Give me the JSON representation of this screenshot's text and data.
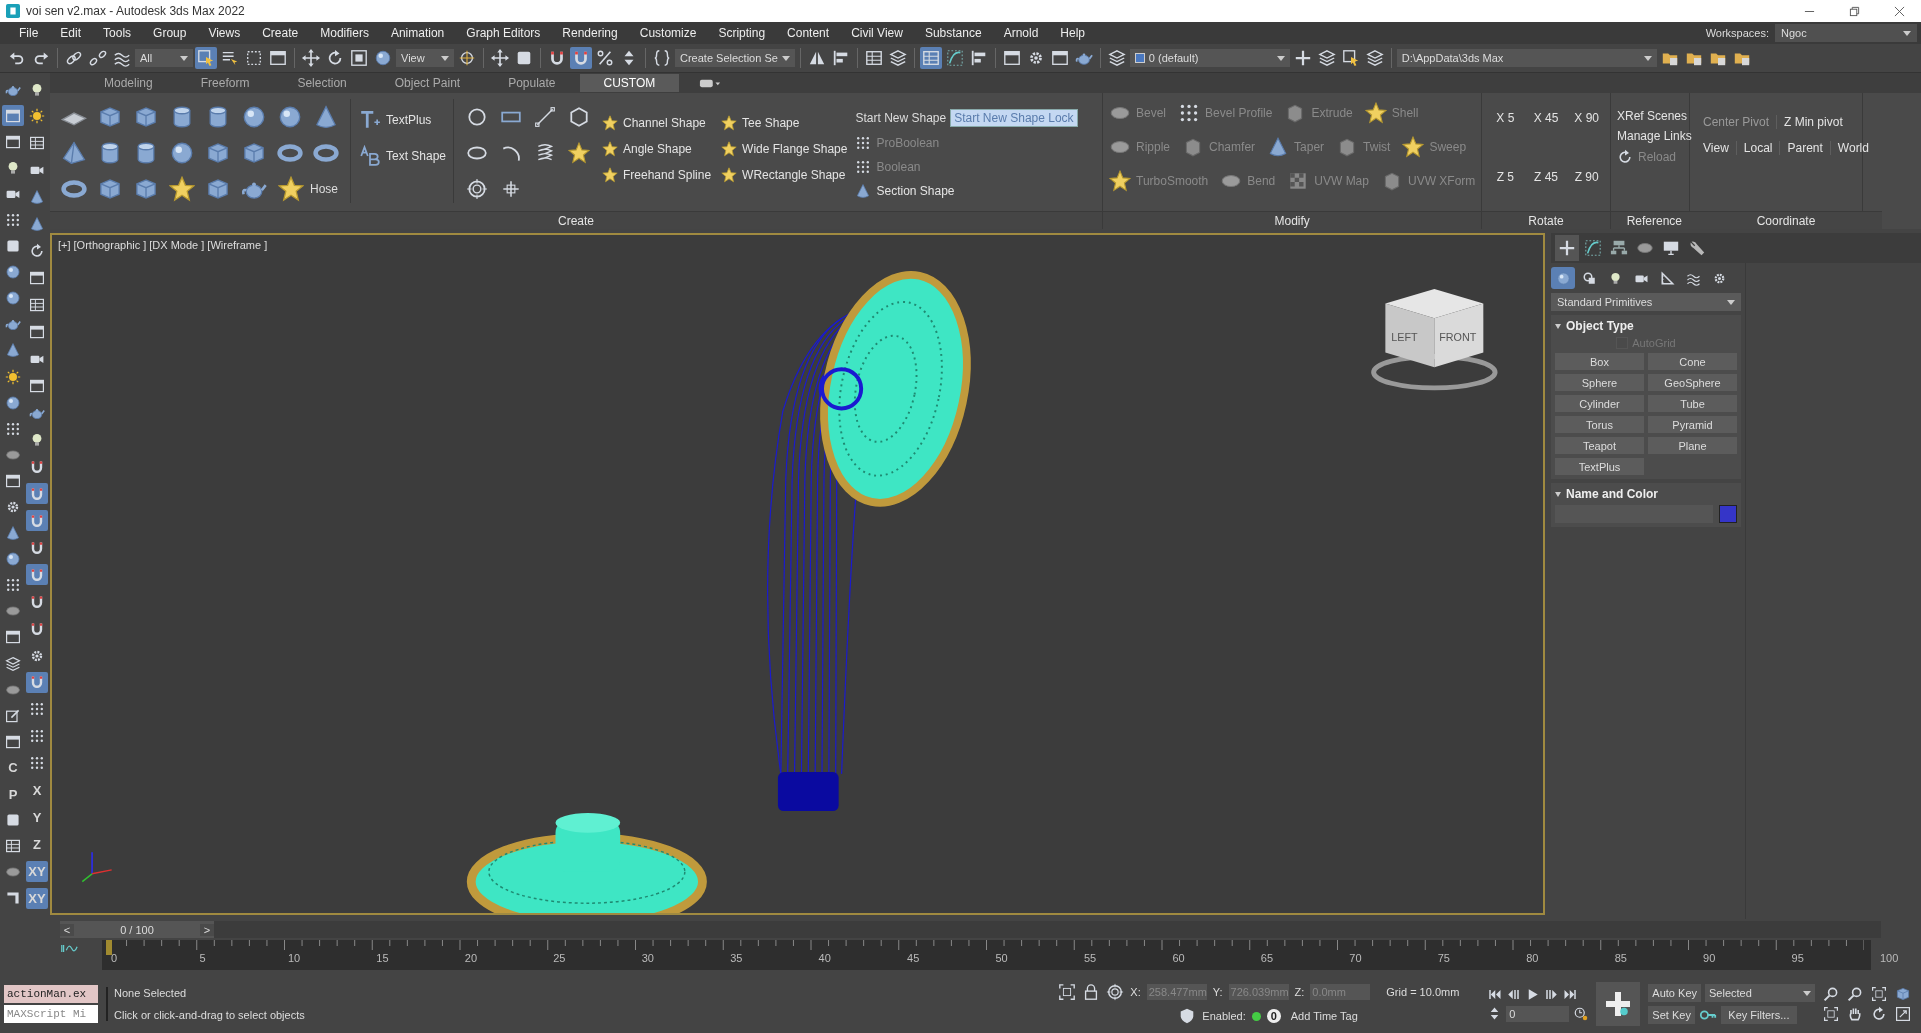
{
  "window": {
    "title": "voi sen v2.max - Autodesk 3ds Max 2022"
  },
  "menu": [
    "File",
    "Edit",
    "Tools",
    "Group",
    "Views",
    "Create",
    "Modifiers",
    "Animation",
    "Graph Editors",
    "Rendering",
    "Customize",
    "Scripting",
    "Content",
    "Civil View",
    "Substance",
    "Arnold",
    "Help"
  ],
  "workspaces": {
    "label": "Workspaces:",
    "value": "Ngoc"
  },
  "toolbar": [
    {
      "kind": "undo",
      "selected": false
    },
    {
      "kind": "redo",
      "selected": false
    },
    {
      "kind": "separator"
    },
    {
      "kind": "link",
      "selected": false
    },
    {
      "kind": "unlink",
      "selected": false
    },
    {
      "kind": "wave",
      "selected": false
    },
    {
      "kind": "dropdown",
      "label": "All"
    },
    {
      "kind": "select",
      "selected": true
    },
    {
      "kind": "list",
      "selected": false
    },
    {
      "kind": "marquee",
      "selected": false
    },
    {
      "kind": "window",
      "selected": false
    },
    {
      "kind": "separator"
    },
    {
      "kind": "move",
      "selected": false
    },
    {
      "kind": "rotate",
      "selected": false
    },
    {
      "kind": "scale",
      "selected": false
    },
    {
      "kind": "sphere",
      "selected": false
    },
    {
      "kind": "dropdown",
      "label": "View"
    },
    {
      "kind": "pivot",
      "selected": false
    },
    {
      "kind": "separator"
    },
    {
      "kind": "move",
      "selected": false
    },
    {
      "kind": "square",
      "selected": false
    },
    {
      "kind": "separator"
    },
    {
      "kind": "magnet",
      "selected": false
    },
    {
      "kind": "magnet",
      "selected": true
    },
    {
      "kind": "percent",
      "selected": false
    },
    {
      "kind": "spinner",
      "selected": false
    },
    {
      "kind": "separator"
    },
    {
      "kind": "braces",
      "selected": false
    },
    {
      "kind": "dropdown",
      "label": "Create Selection Se"
    },
    {
      "kind": "separator"
    },
    {
      "kind": "mirror",
      "selected": false
    },
    {
      "kind": "align",
      "selected": false
    },
    {
      "kind": "separator"
    },
    {
      "kind": "table",
      "selected": false
    },
    {
      "kind": "layers",
      "selected": false
    },
    {
      "kind": "separator"
    },
    {
      "kind": "table",
      "selected": true
    },
    {
      "kind": "curve",
      "selected": false
    },
    {
      "kind": "align",
      "selected": false
    },
    {
      "kind": "separator"
    },
    {
      "kind": "window",
      "selected": false
    },
    {
      "kind": "gear",
      "selected": false
    },
    {
      "kind": "window",
      "selected": false
    },
    {
      "kind": "teapot",
      "selected": false
    },
    {
      "kind": "separator"
    },
    {
      "kind": "layers",
      "selected": false
    },
    {
      "kind": "layer-dropdown",
      "label": "0 (default)"
    },
    {
      "kind": "plus",
      "selected": false
    },
    {
      "kind": "layers",
      "selected": false
    },
    {
      "kind": "select",
      "selected": false
    },
    {
      "kind": "layers",
      "selected": false
    },
    {
      "kind": "separator"
    },
    {
      "kind": "path-dropdown",
      "label": "D:\\AppData\\3ds Max"
    },
    {
      "kind": "folder",
      "selected": false
    },
    {
      "kind": "folder",
      "selected": false
    },
    {
      "kind": "folder",
      "selected": false
    },
    {
      "kind": "folder",
      "selected": false
    }
  ],
  "ribbon_tabs": [
    {
      "label": "Modeling",
      "selected": false
    },
    {
      "label": "Freeform",
      "selected": false
    },
    {
      "label": "Selection",
      "selected": false
    },
    {
      "label": "Object Paint",
      "selected": false
    },
    {
      "label": "Populate",
      "selected": false
    },
    {
      "label": "CUSTOM",
      "selected": true
    }
  ],
  "create_panel": {
    "title": "Create",
    "primitives": [
      {
        "kind": "plane"
      },
      {
        "kind": "box"
      },
      {
        "kind": "box"
      },
      {
        "kind": "cylinder"
      },
      {
        "kind": "cylinder"
      },
      {
        "kind": "sphere"
      },
      {
        "kind": "sphere"
      },
      {
        "kind": "cone"
      },
      {
        "kind": "pyramid"
      },
      {
        "kind": "cylinder"
      },
      {
        "kind": "cylinder"
      },
      {
        "kind": "sphere"
      },
      {
        "kind": "box"
      },
      {
        "kind": "box"
      },
      {
        "kind": "torus"
      },
      {
        "kind": "torus"
      },
      {
        "kind": "torus"
      },
      {
        "kind": "box"
      },
      {
        "kind": "box"
      },
      {
        "kind": "star"
      },
      {
        "kind": "box"
      },
      {
        "kind": "teapot"
      },
      {
        "kind": "star",
        "label": "Hose"
      }
    ],
    "text_tools": [
      {
        "kind": "textplus",
        "label": "TextPlus"
      },
      {
        "kind": "textshape",
        "label": "Text Shape"
      }
    ],
    "splines": [
      {
        "kind": "circle"
      },
      {
        "kind": "rect"
      },
      {
        "kind": "line"
      },
      {
        "kind": "ngon"
      },
      {
        "kind": "ellipse"
      },
      {
        "kind": "arc"
      },
      {
        "kind": "helix"
      },
      {
        "kind": "star"
      },
      {
        "kind": "target"
      },
      {
        "kind": "cross"
      }
    ],
    "extended_shapes": [
      "Channel Shape",
      "Tee Shape",
      "Angle Shape",
      "Wide Flange Shape",
      "Freehand Spline",
      "WRectangle Shape"
    ],
    "start_new_shape": {
      "label": "Start New Shape",
      "value": "Start New Shape Lock"
    },
    "compound": [
      {
        "label": "ProBoolean",
        "disabled": true
      },
      {
        "label": "Boolean",
        "disabled": true
      },
      {
        "label": "Section Shape",
        "disabled": false
      }
    ]
  },
  "modify_panel": {
    "title": "Modify",
    "rows": [
      [
        {
          "kind": "disc",
          "label": "Bevel",
          "disabled": true
        },
        {
          "kind": "dots",
          "label": "Bevel Profile",
          "disabled": true
        },
        {
          "kind": "block",
          "label": "Extrude",
          "disabled": true
        },
        {
          "kind": "star",
          "label": "Shell",
          "disabled": true
        }
      ],
      [
        {
          "kind": "disc",
          "label": "Ripple",
          "disabled": true
        },
        {
          "kind": "block",
          "label": "Chamfer",
          "disabled": true
        },
        {
          "kind": "cone",
          "label": "Taper",
          "disabled": true
        },
        {
          "kind": "block",
          "label": "Twist",
          "disabled": true
        },
        {
          "kind": "star",
          "label": "Sweep",
          "disabled": true
        }
      ],
      [
        {
          "kind": "star",
          "label": "TurboSmooth",
          "disabled": true
        },
        {
          "kind": "disc",
          "label": "Bend",
          "disabled": true
        },
        {
          "kind": "checker",
          "label": "UVW Map",
          "disabled": true
        },
        {
          "kind": "block",
          "label": "UVW XForm",
          "disabled": true
        }
      ]
    ]
  },
  "rotate_panel": {
    "title": "Rotate",
    "buttons": [
      "X 5",
      "X 45",
      "X 90",
      "Z 5",
      "Z 45",
      "Z 90"
    ]
  },
  "reference_panel": {
    "title": "Reference",
    "items": [
      {
        "label": "XRef Scenes",
        "disabled": false
      },
      {
        "label": "Manage Links",
        "disabled": false
      },
      {
        "label": "Reload",
        "disabled": true
      }
    ]
  },
  "coordinate_panel": {
    "title": "Coordinate",
    "pivot_buttons": [
      {
        "label": "Center Pivot",
        "disabled": true
      },
      {
        "label": "Z Min pivot",
        "disabled": false
      }
    ],
    "space_buttons": [
      {
        "label": "View",
        "disabled": false
      },
      {
        "label": "Local",
        "disabled": false
      },
      {
        "label": "Parent",
        "disabled": false
      },
      {
        "label": "World",
        "disabled": false
      }
    ]
  },
  "left_strip": {
    "column_1": [
      {
        "kind": "teapot",
        "selected": false
      },
      {
        "kind": "window",
        "selected": true
      },
      {
        "kind": "window",
        "selected": false
      },
      {
        "kind": "bulb",
        "selected": false
      },
      {
        "kind": "camera",
        "selected": false
      },
      {
        "kind": "dots",
        "selected": false
      },
      {
        "kind": "square",
        "selected": false
      },
      {
        "kind": "sphere",
        "selected": false
      },
      {
        "kind": "sphere",
        "selected": false
      },
      {
        "kind": "teapot",
        "selected": false
      },
      {
        "kind": "cone",
        "selected": false
      },
      {
        "kind": "sun",
        "selected": false
      },
      {
        "kind": "sphere",
        "selected": false
      },
      {
        "kind": "dots",
        "selected": false
      },
      {
        "kind": "disc",
        "selected": false
      },
      {
        "kind": "window",
        "selected": false
      },
      {
        "kind": "gear",
        "selected": false
      },
      {
        "kind": "cone",
        "selected": false
      },
      {
        "kind": "sphere",
        "selected": false
      },
      {
        "kind": "dots",
        "selected": false
      },
      {
        "kind": "disc",
        "selected": false
      },
      {
        "kind": "window",
        "selected": false
      },
      {
        "kind": "layers",
        "selected": false
      },
      {
        "kind": "disc",
        "selected": false
      },
      {
        "kind": "edit",
        "selected": false
      },
      {
        "kind": "window",
        "selected": false
      },
      {
        "kind": "letter",
        "label": "C",
        "selected": false
      },
      {
        "kind": "letter",
        "label": "P",
        "selected": false
      },
      {
        "kind": "square",
        "selected": false
      },
      {
        "kind": "table",
        "selected": false
      },
      {
        "kind": "disc",
        "selected": false
      },
      {
        "kind": "corner",
        "selected": false
      }
    ],
    "column_2": [
      {
        "kind": "bulb",
        "selected": false
      },
      {
        "kind": "sun",
        "selected": false
      },
      {
        "kind": "table",
        "selected": false
      },
      {
        "kind": "camera",
        "selected": false
      },
      {
        "kind": "cone",
        "selected": false
      },
      {
        "kind": "cone",
        "selected": false
      },
      {
        "kind": "rotate",
        "selected": false
      },
      {
        "kind": "window",
        "selected": false
      },
      {
        "kind": "table",
        "selected": false
      },
      {
        "kind": "window",
        "selected": false
      },
      {
        "kind": "camera",
        "selected": false
      },
      {
        "kind": "window",
        "selected": false
      },
      {
        "kind": "teapot",
        "selected": false
      },
      {
        "kind": "bulb",
        "selected": false
      },
      {
        "kind": "magnet",
        "selected": false
      },
      {
        "kind": "magnet",
        "selected": true
      },
      {
        "kind": "magnet",
        "selected": true
      },
      {
        "kind": "magnet",
        "selected": false
      },
      {
        "kind": "magnet",
        "selected": true
      },
      {
        "kind": "magnet",
        "selected": false
      },
      {
        "kind": "magnet",
        "selected": false
      },
      {
        "kind": "gear",
        "selected": false
      },
      {
        "kind": "magnet",
        "selected": true
      },
      {
        "kind": "dots",
        "selected": false
      },
      {
        "kind": "dots",
        "selected": false
      },
      {
        "kind": "dots",
        "selected": false
      },
      {
        "kind": "letter",
        "label": "X",
        "selected": false
      },
      {
        "kind": "letter",
        "label": "Y",
        "selected": false
      },
      {
        "kind": "letter",
        "label": "Z",
        "selected": false
      },
      {
        "kind": "letter",
        "label": "XY",
        "selected": true
      },
      {
        "kind": "letter",
        "label": "XY",
        "selected": true
      }
    ]
  },
  "viewport": {
    "labels": [
      "[+]",
      "[Orthographic ]",
      "[DX Mode ]",
      "[Wireframe ]"
    ],
    "active": true,
    "viewcube": [
      "LEFT",
      "FRONT"
    ]
  },
  "command_panel": {
    "tabs": [
      {
        "kind": "plus",
        "selected": true
      },
      {
        "kind": "curve",
        "selected": false
      },
      {
        "kind": "hierarchy",
        "selected": false
      },
      {
        "kind": "disc",
        "selected": false
      },
      {
        "kind": "monitor",
        "selected": false
      },
      {
        "kind": "wrench",
        "selected": false
      }
    ],
    "categories": [
      {
        "kind": "sphere",
        "selected": true
      },
      {
        "kind": "shapes",
        "selected": false
      },
      {
        "kind": "bulb",
        "selected": false
      },
      {
        "kind": "camera",
        "selected": false
      },
      {
        "kind": "ruler",
        "selected": false
      },
      {
        "kind": "wave",
        "selected": false
      },
      {
        "kind": "gear",
        "selected": false
      }
    ],
    "category_dropdown": "Standard Primitives",
    "object_type": {
      "title": "Object Type",
      "expanded": true,
      "autogrid": {
        "label": "AutoGrid",
        "checked": false,
        "disabled": true
      },
      "buttons": [
        "Box",
        "Cone",
        "Sphere",
        "GeoSphere",
        "Cylinder",
        "Tube",
        "Torus",
        "Pyramid",
        "Teapot",
        "Plane",
        "TextPlus"
      ]
    },
    "name_and_color": {
      "title": "Name and Color",
      "expanded": true,
      "color": "#3535c8"
    }
  },
  "timeline": {
    "prev": "<",
    "slider_label": "0 / 100",
    "next": ">",
    "level": 0,
    "ticks": [
      "0",
      "5",
      "10",
      "15",
      "20",
      "25",
      "30",
      "35",
      "40",
      "45",
      "50",
      "55",
      "60",
      "65",
      "70",
      "75",
      "80",
      "85",
      "90",
      "95",
      "100"
    ]
  },
  "status": {
    "listener": "actionMan.ex",
    "mini_listener": "MAXScript Mi",
    "selection": "None Selected",
    "prompt": "Click or click-and-drag to select objects",
    "coords": [
      {
        "axis": "X:",
        "value": "258.477mm"
      },
      {
        "axis": "Y:",
        "value": "726.039mm"
      },
      {
        "axis": "Z:",
        "value": "0.0mm"
      }
    ],
    "grid": "Grid = 10.0mm",
    "time_tag": {
      "enabled_label": "Enabled:",
      "enabled": true,
      "count": "0",
      "label": "Add Time Tag"
    },
    "frame": "0",
    "auto_key": {
      "label": "Auto Key",
      "on": false
    },
    "key_mode": "Selected",
    "set_key": "Set Key",
    "key_filters": "Key Filters..."
  }
}
